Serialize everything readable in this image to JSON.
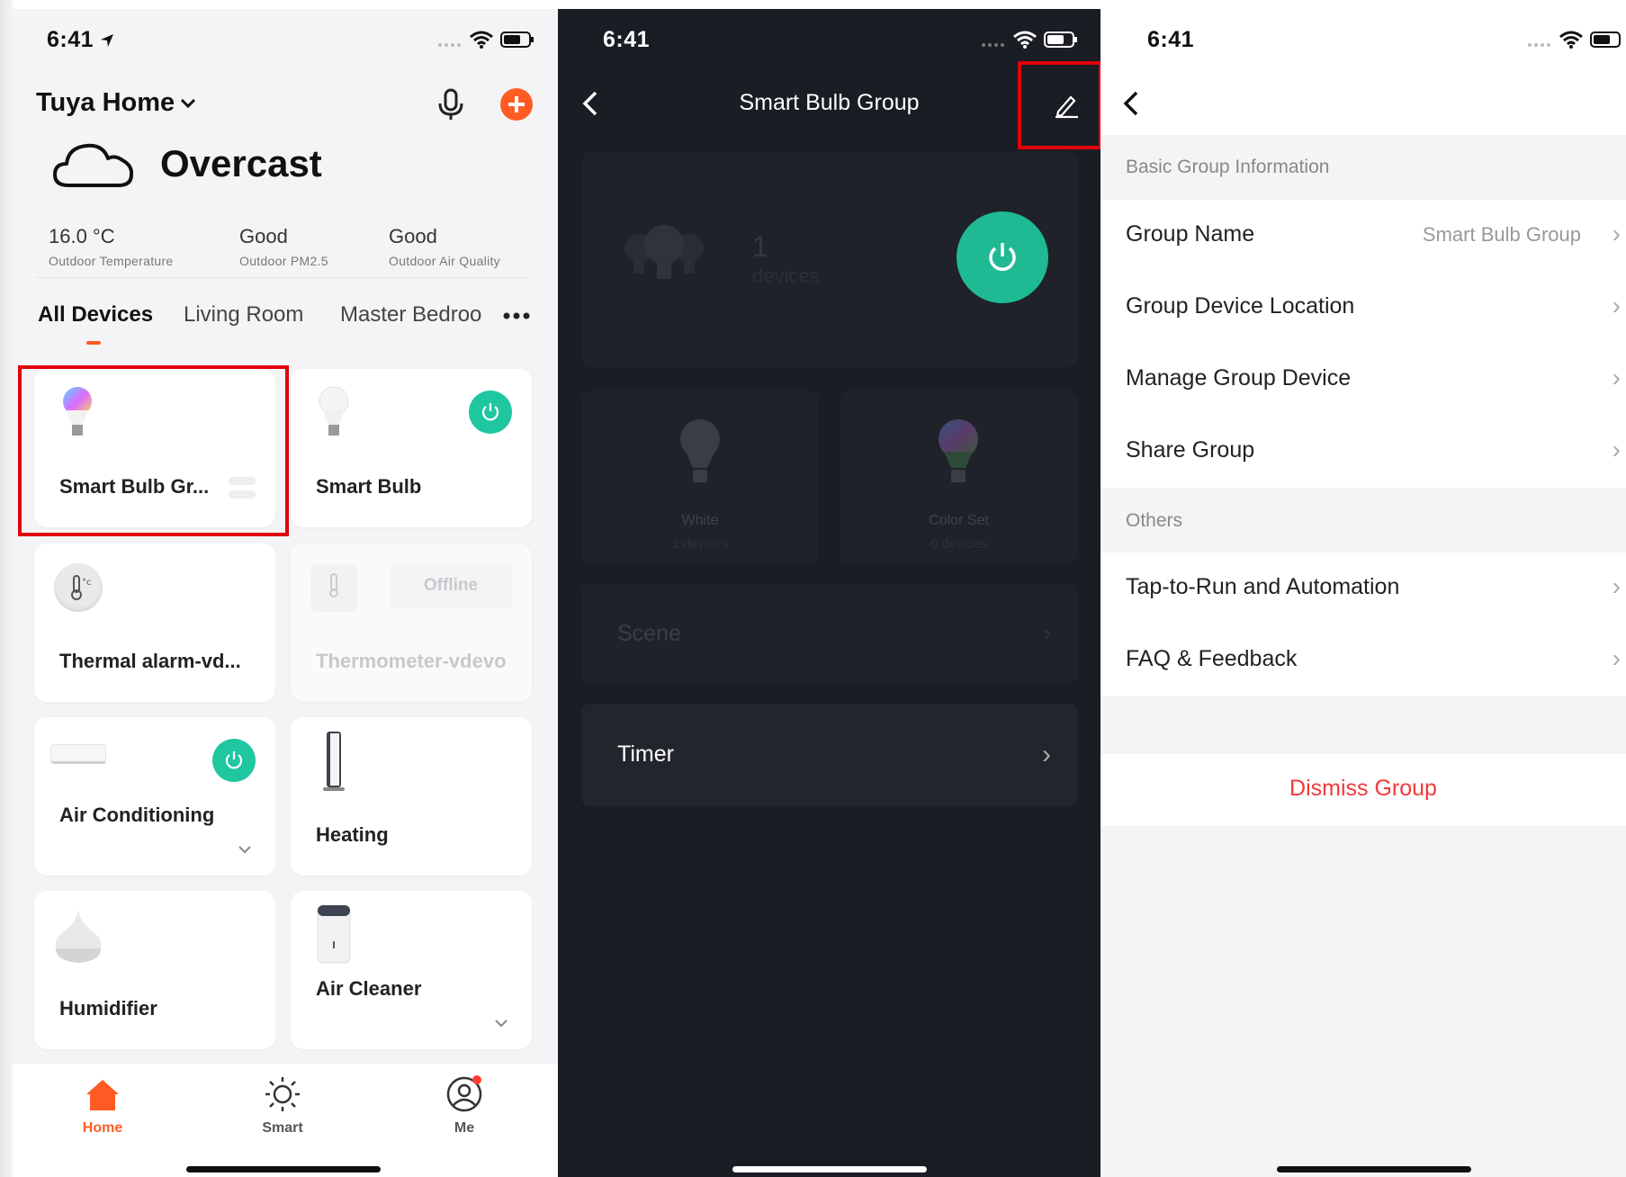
{
  "status": {
    "time": "6:41"
  },
  "home": {
    "title": "Tuya Home",
    "weather": {
      "condition": "Overcast",
      "stats": [
        {
          "value": "16.0 °C",
          "label": "Outdoor Temperature"
        },
        {
          "value": "Good",
          "label": "Outdoor PM2.5"
        },
        {
          "value": "Good",
          "label": "Outdoor Air Quality"
        }
      ]
    },
    "tabs": [
      "All Devices",
      "Living Room",
      "Master Bedroo"
    ],
    "devices": [
      {
        "name": "Smart Bulb Gr...",
        "power_on": false
      },
      {
        "name": "Smart Bulb",
        "power_on": true
      },
      {
        "name": "Thermal alarm-vd...",
        "power_on": false
      },
      {
        "name": "Thermometer-vdevo",
        "status": "Offline"
      },
      {
        "name": "Air Conditioning",
        "power_on": true
      },
      {
        "name": "Heating",
        "power_on": false
      },
      {
        "name": "Humidifier",
        "power_on": false
      },
      {
        "name": "Air Cleaner",
        "power_on": false
      }
    ],
    "tabbar": [
      {
        "label": "Home",
        "icon": "home-icon",
        "active": true
      },
      {
        "label": "Smart",
        "icon": "sun-icon",
        "active": false
      },
      {
        "label": "Me",
        "icon": "profile-icon",
        "active": false
      }
    ],
    "accent": "#ff5b23",
    "power_color": "#1fc7a0"
  },
  "group": {
    "title": "Smart Bulb Group",
    "device_count": "1",
    "device_count_label": "devices",
    "modes": [
      {
        "label": "White",
        "sub": "1 devices"
      },
      {
        "label": "Color Set",
        "sub": "0 devices"
      }
    ],
    "rows": [
      {
        "label": "Scene",
        "enabled": false
      },
      {
        "label": "Timer",
        "enabled": true
      }
    ]
  },
  "settings": {
    "sections": [
      {
        "header": "Basic Group Information",
        "rows": [
          {
            "label": "Group Name",
            "value": "Smart Bulb Group"
          },
          {
            "label": "Group Device Location"
          },
          {
            "label": "Manage Group Device"
          },
          {
            "label": "Share Group"
          }
        ]
      },
      {
        "header": "Others",
        "rows": [
          {
            "label": "Tap-to-Run and Automation"
          },
          {
            "label": "FAQ & Feedback"
          }
        ]
      }
    ],
    "dismiss_label": "Dismiss Group",
    "danger_color": "#f2383a"
  }
}
